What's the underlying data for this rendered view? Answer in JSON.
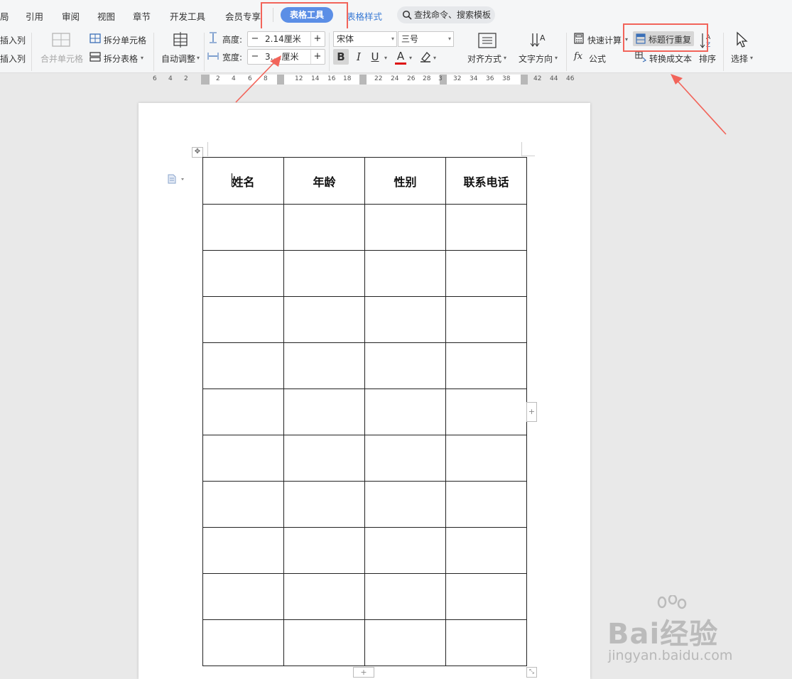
{
  "menu": {
    "items": [
      "局",
      "引用",
      "审阅",
      "视图",
      "章节",
      "开发工具",
      "会员专享"
    ],
    "active_tab": "表格工具",
    "next_tab": "表格样式",
    "search_label": "查找命令、搜索模板"
  },
  "ribbon": {
    "insert_col_1": "插入列",
    "insert_col_2": "插入列",
    "merge_cells": "合并单元格",
    "split_cells": "拆分单元格",
    "split_table": "拆分表格",
    "auto_adjust": "自动调整",
    "height_label": "高度:",
    "height_value": "2.14厘米",
    "width_label": "宽度:",
    "width_value": "3.…厘米",
    "font_name": "宋体",
    "font_size": "三号",
    "bold": "B",
    "italic": "I",
    "underline": "U",
    "font_color": "A",
    "align": "对齐方式",
    "text_direction": "文字方向",
    "quick_calc": "快速计算",
    "formula": "公式",
    "fx": "fx",
    "header_repeat": "标题行重复",
    "convert_text": "转换成文本",
    "sort": "排序",
    "select": "选择"
  },
  "ruler": {
    "numbers": [
      "6",
      "4",
      "2",
      "2",
      "4",
      "6",
      "8",
      "12",
      "14",
      "16",
      "18",
      "22",
      "24",
      "26",
      "28",
      "3",
      "32",
      "34",
      "36",
      "38",
      "42",
      "44",
      "46"
    ]
  },
  "table": {
    "headers": [
      "姓名",
      "年龄",
      "性别",
      "联系电话"
    ],
    "empty_rows": 10
  },
  "watermark": {
    "brand": "Bai经验",
    "url": "jingyan.baidu.com"
  },
  "colors": {
    "accent": "#5b8ee6",
    "highlight": "#f2645a",
    "background": "#e9e9e9"
  }
}
